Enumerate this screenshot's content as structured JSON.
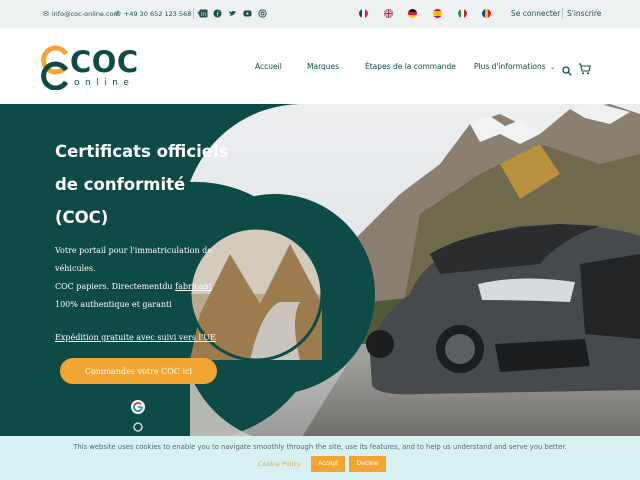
{
  "topbar": {
    "email": "info@coc-online.com",
    "phone": "+49 30 652 123 568",
    "social_icons": [
      "linkedin-icon",
      "facebook-icon",
      "twitter-icon",
      "youtube-icon",
      "instagram-icon"
    ],
    "languages": [
      "fr",
      "en",
      "de",
      "es",
      "it",
      "ro"
    ],
    "login_label": "Se connecter",
    "register_label": "S'inscrire"
  },
  "brand": {
    "name": "COC",
    "subtitle": "online",
    "color_primary": "#0e4a46",
    "color_accent": "#f2a531"
  },
  "nav": {
    "items": [
      "Accueil",
      "Marques",
      "Étapes de la commande",
      "Plus d'informations"
    ]
  },
  "hero": {
    "title_lines": [
      "Certificats officiels",
      "de conformité",
      "(COC)"
    ],
    "paragraph_lines": [
      "Votre portail pour l'immatriculation de",
      "véhicules.",
      "COC papiers. Directementdu ",
      "fabricant",
      "100% authentique et garanti"
    ],
    "shipping_link": "Expédition gratuite avec suivi vers l'UE",
    "cta_label": "Commandes votre COC ici"
  },
  "cookie": {
    "message": "This website uses cookies to enable you to navigate smoothly through the site, use its features, and to help us understand and serve you better.",
    "policy_label": "Cookie Policy",
    "accept_label": "Accept",
    "decline_label": "Decline"
  }
}
